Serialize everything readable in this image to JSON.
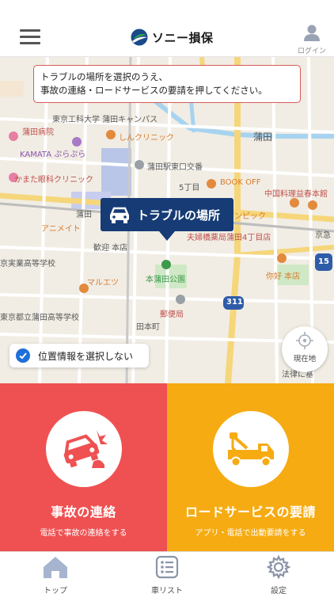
{
  "header": {
    "logo_text": "ソニー損保",
    "login_label": "ログイン",
    "menu_icon": "hamburger-icon",
    "login_icon": "user-icon"
  },
  "map": {
    "notice": "トラブルの場所を選択のうえ、\n事故の連絡・ロードサービスの要請を押してください。",
    "pin_label": "トラブルの場所",
    "current_location_label": "現在地",
    "no_location_label": "位置情報を選択しない",
    "labels": {
      "kamata": "蒲田",
      "tokyo_kogyo": "東京工科大学 蒲田キャンパス",
      "kamata_hospital": "蒲田病院",
      "shin_clinic": "しんクリニック",
      "kamata_purapura": "KAMATA ぷらぷら",
      "kamata_east_exit": "蒲田駅東口交番",
      "kamata_eye": "かまた眼科クリニック",
      "box_off": "BOOK OFF",
      "chuka": "中国料理益春本館",
      "gochome": "5丁目",
      "kamata_st": "蒲田",
      "animate": "アニメイト",
      "kangei": "歓迎 本店",
      "marue": "マルエツ",
      "fuufu": "夫婦橋薬局蒲田4丁目店",
      "hon_kamata_park": "本蒲田公園",
      "yuubinkyoku": "郵便局",
      "niyo": "你好 本店",
      "jitsugyo": "京実業高等学校",
      "kamata_hs": "東京都立蒲田高等学校",
      "hon_cho": "田本町",
      "route_311": "311",
      "route_15": "15",
      "keikyu": "京急",
      "houritsu": "法律に基",
      "pinku": "ンピック"
    }
  },
  "actions": {
    "accident": {
      "title": "事故の連絡",
      "subtitle": "電話で事故の連絡をする",
      "color": "#ef5152",
      "icon": "car-crash-icon"
    },
    "road_service": {
      "title": "ロードサービスの要請",
      "subtitle": "アプリ・電話で出動要請をする",
      "color": "#f6ab12",
      "icon": "tow-truck-icon"
    }
  },
  "tabbar": {
    "items": [
      {
        "label": "トップ",
        "icon": "home-icon"
      },
      {
        "label": "車リスト",
        "icon": "list-icon"
      },
      {
        "label": "設定",
        "icon": "gear-icon"
      }
    ]
  }
}
